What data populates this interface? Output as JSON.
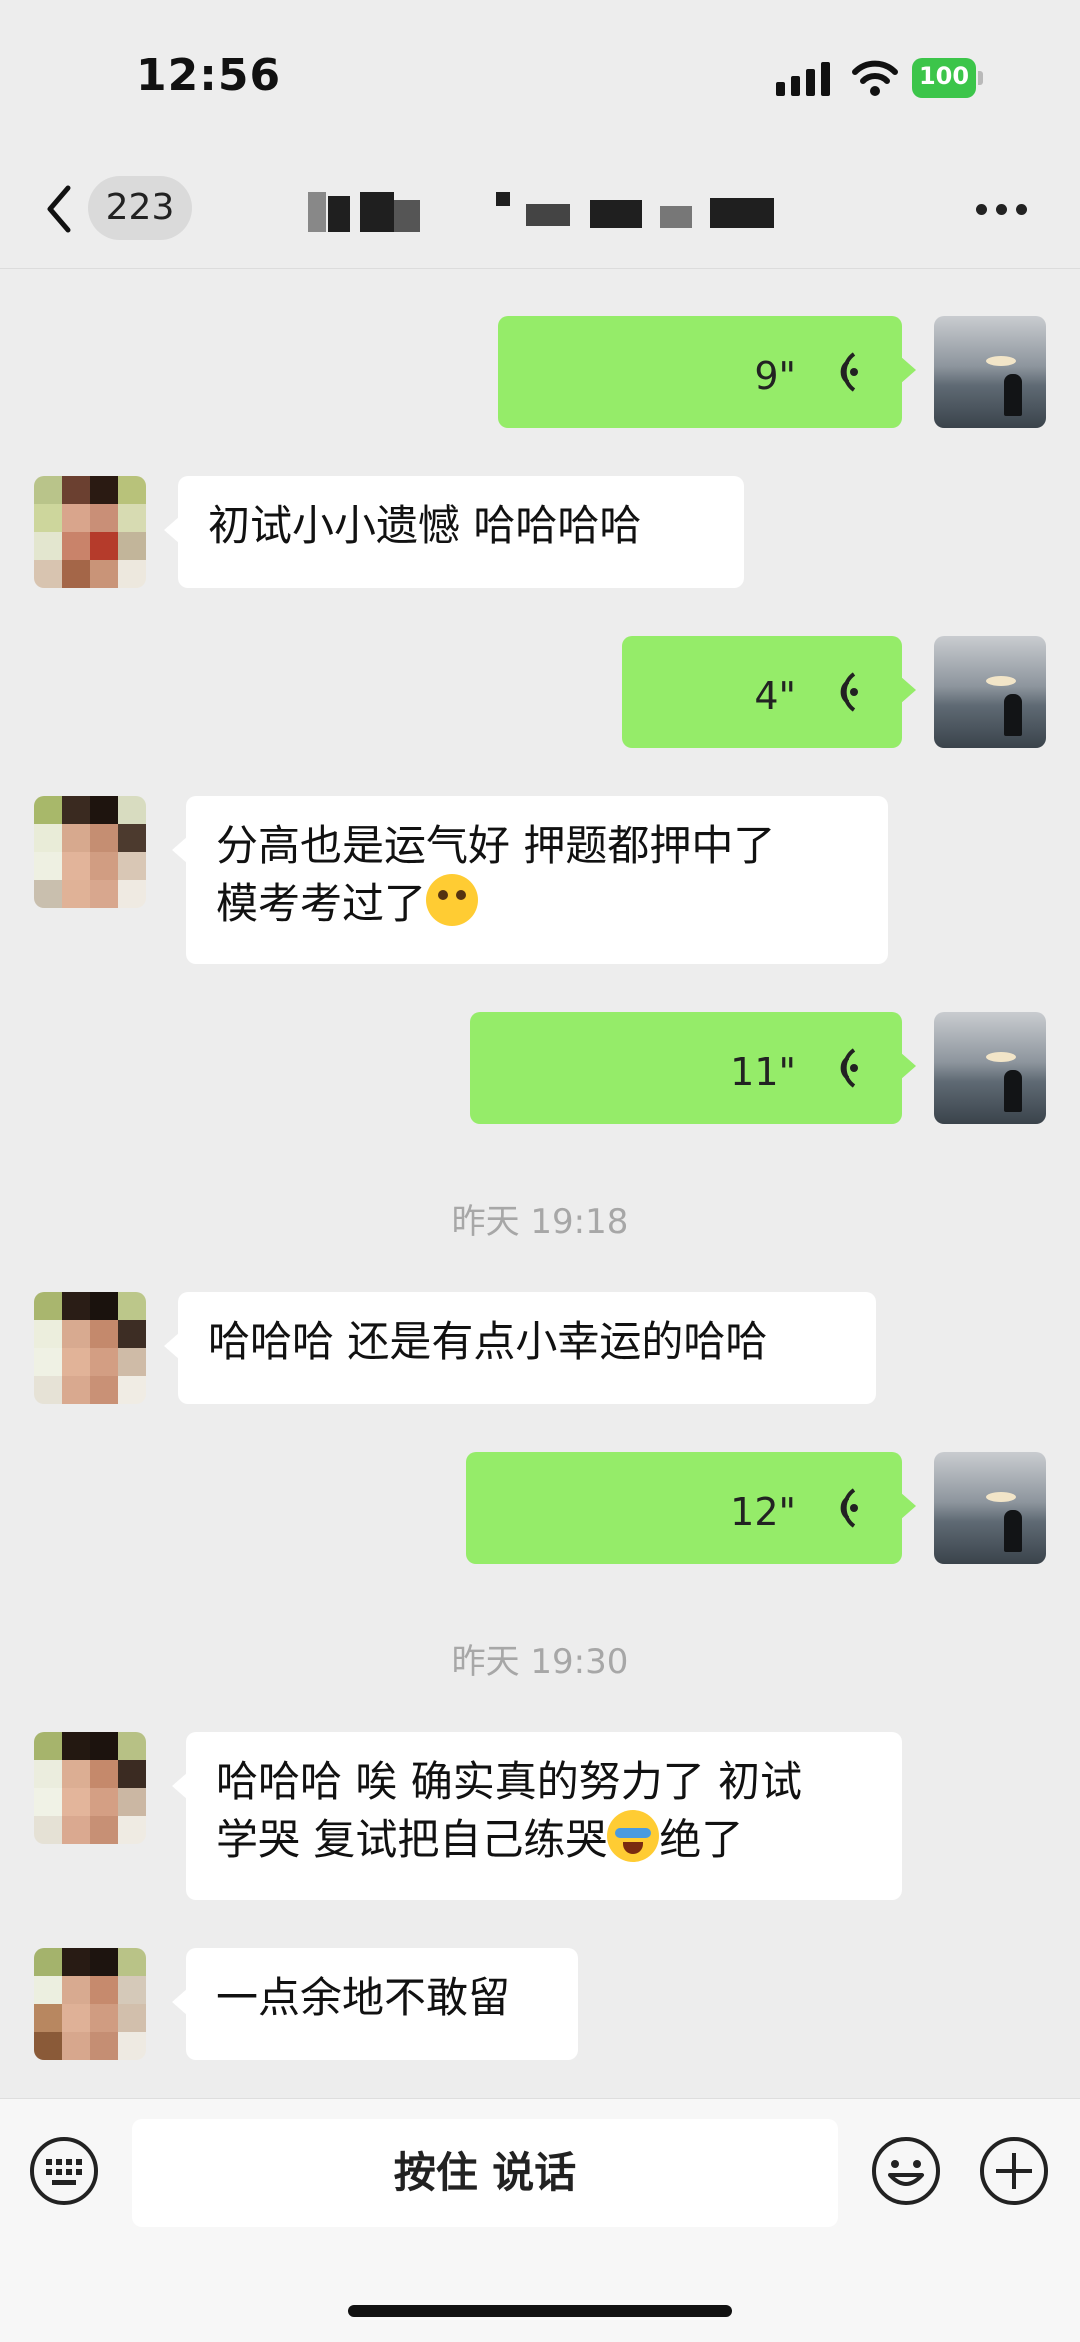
{
  "status_bar": {
    "time": "12:56",
    "battery": "100",
    "icons": [
      "signal-icon",
      "wifi-icon",
      "battery-icon"
    ]
  },
  "nav": {
    "unread_count": "223",
    "title_redacted": true,
    "icons": [
      "back-icon",
      "more-icon"
    ]
  },
  "messages": [
    {
      "from": "me",
      "type": "voice",
      "duration": "9\""
    },
    {
      "from": "them",
      "type": "text",
      "lines": [
        "初试小小遗憾 哈哈哈哈"
      ]
    },
    {
      "from": "me",
      "type": "voice",
      "duration": "4\""
    },
    {
      "from": "them",
      "type": "text",
      "lines": [
        "分高也是运气好 押题都押中了",
        "模考考过了"
      ]
    },
    {
      "from": "me",
      "type": "voice",
      "duration": "11\""
    },
    {
      "type": "timestamp",
      "text": "昨天 19:18"
    },
    {
      "from": "them",
      "type": "text",
      "lines": [
        "哈哈哈 还是有点小幸运的哈哈"
      ]
    },
    {
      "from": "me",
      "type": "voice",
      "duration": "12\""
    },
    {
      "type": "timestamp",
      "text": "昨天 19:30"
    },
    {
      "from": "them",
      "type": "text",
      "lines": [
        "哈哈哈 唉 确实真的努力了 初试",
        "学哭 复试把自己练哭",
        "绝了"
      ]
    },
    {
      "from": "them",
      "type": "text",
      "lines": [
        "一点余地不敢留"
      ]
    }
  ],
  "input_bar": {
    "hold_to_talk_label": "按住 说话",
    "icons": [
      "keyboard-icon",
      "emoji-icon",
      "plus-icon"
    ]
  },
  "colors": {
    "background": "#ededed",
    "my_bubble": "#95ec69",
    "their_bubble": "#ffffff",
    "battery": "#3cc54a",
    "timestamp_text": "#a7a7a7"
  }
}
